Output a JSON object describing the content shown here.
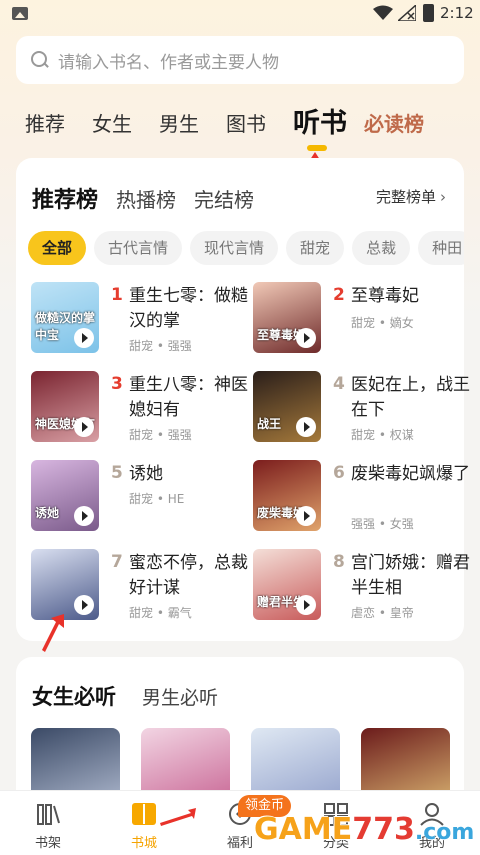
{
  "status": {
    "time": "2:12"
  },
  "search": {
    "placeholder": "请输入书名、作者或主要人物"
  },
  "top_tabs": [
    {
      "label": "推荐"
    },
    {
      "label": "女生"
    },
    {
      "label": "男生"
    },
    {
      "label": "图书"
    },
    {
      "label": "听书"
    },
    {
      "label": "必读榜"
    }
  ],
  "ranking": {
    "tabs": [
      {
        "label": "推荐榜"
      },
      {
        "label": "热播榜"
      },
      {
        "label": "完结榜"
      }
    ],
    "full_list": "完整榜单",
    "chips": [
      {
        "label": "全部"
      },
      {
        "label": "古代言情"
      },
      {
        "label": "现代言情"
      },
      {
        "label": "甜宠"
      },
      {
        "label": "总裁"
      },
      {
        "label": "种田"
      }
    ],
    "books": [
      {
        "rank": "1",
        "title": "重生七零：做糙汉的掌",
        "tags": "甜宠 • 强强",
        "cover_text": "做糙汉的掌中宝",
        "colors": [
          "#bfe3f6",
          "#7cc2e8"
        ]
      },
      {
        "rank": "2",
        "title": "至尊毒妃",
        "tags": "甜宠 • 嫡女",
        "cover_text": "至尊毒妃",
        "colors": [
          "#f1c9b7",
          "#6e2a2a"
        ]
      },
      {
        "rank": "3",
        "title": "重生八零：神医媳妇有",
        "tags": "甜宠 • 强强",
        "cover_text": "神医媳妇有",
        "colors": [
          "#7a2430",
          "#d9a0a5"
        ]
      },
      {
        "rank": "4",
        "title": "医妃在上，战王在下",
        "tags": "甜宠 • 权谋",
        "cover_text": "战王",
        "colors": [
          "#2a1e1a",
          "#a67a3b"
        ]
      },
      {
        "rank": "5",
        "title": "诱她",
        "tags": "甜宠 • HE",
        "cover_text": "诱她",
        "colors": [
          "#d8b6e0",
          "#7a5a8a"
        ]
      },
      {
        "rank": "6",
        "title": "废柴毒妃飒爆了",
        "tags": "强强 • 女强",
        "cover_text": "废柴毒妃",
        "colors": [
          "#7b1d1d",
          "#e0a36b"
        ]
      },
      {
        "rank": "7",
        "title": "蜜恋不停，总裁好计谋",
        "tags": "甜宠 • 霸气",
        "cover_text": "",
        "colors": [
          "#d9dff0",
          "#4c5a8a"
        ]
      },
      {
        "rank": "8",
        "title": "宫门娇娥：赠君半生相",
        "tags": "虐恋 • 皇帝",
        "cover_text": "赠君半生",
        "colors": [
          "#f4dfd8",
          "#c85a5a"
        ]
      }
    ]
  },
  "section": {
    "tabs": [
      {
        "label": "女生必听"
      },
      {
        "label": "男生必听"
      }
    ],
    "covers": [
      {
        "colors": [
          "#3b4a66",
          "#b9c3d8"
        ]
      },
      {
        "colors": [
          "#f2d5e3",
          "#c45a8c"
        ]
      },
      {
        "colors": [
          "#dfe8f3",
          "#8b9ac7"
        ]
      },
      {
        "colors": [
          "#6b1b1b",
          "#e4c27a"
        ]
      }
    ]
  },
  "nav": [
    {
      "label": "书架",
      "icon": "bookshelf-icon"
    },
    {
      "label": "书城",
      "icon": "bookstore-icon"
    },
    {
      "label": "福利",
      "icon": "gift-icon"
    },
    {
      "label": "分类",
      "icon": "category-icon"
    },
    {
      "label": "我的",
      "icon": "profile-icon"
    }
  ],
  "coin_badge": "领金币",
  "watermark": {
    "text": "GAME773.com",
    "colors": [
      "#f6a21a",
      "#e43b32",
      "#3aa6dd"
    ]
  }
}
